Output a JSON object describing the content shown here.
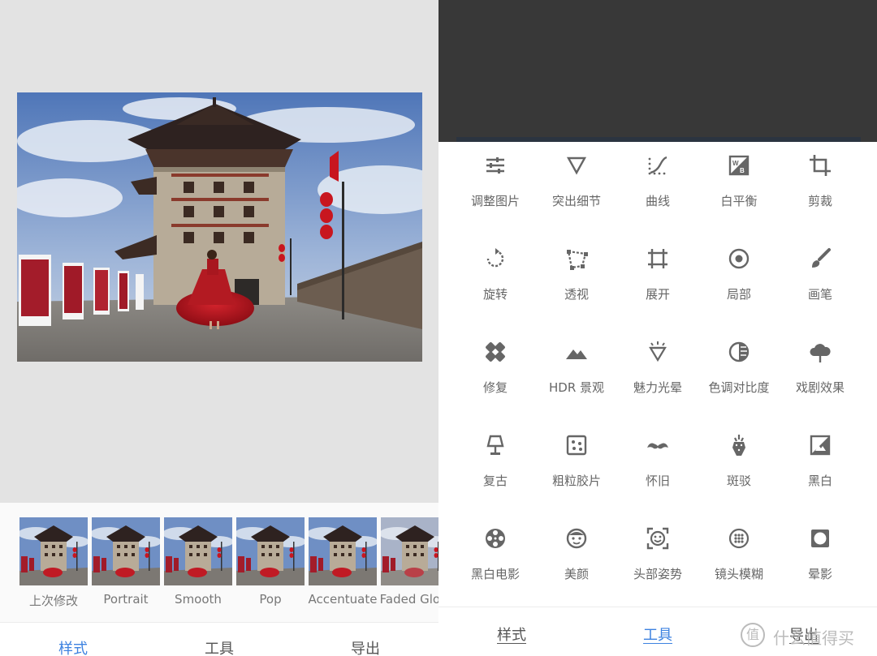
{
  "filters": {
    "items": [
      {
        "label": "上次修改",
        "tone": "normal"
      },
      {
        "label": "Portrait",
        "tone": "normal"
      },
      {
        "label": "Smooth",
        "tone": "normal"
      },
      {
        "label": "Pop",
        "tone": "normal"
      },
      {
        "label": "Accentuate",
        "tone": "normal"
      },
      {
        "label": "Faded Glow",
        "tone": "faded"
      }
    ]
  },
  "left_nav": {
    "styles": "样式",
    "tools": "工具",
    "export": "导出",
    "active": "styles"
  },
  "tools": {
    "items": [
      {
        "label": "调整图片",
        "icon": "tune-icon"
      },
      {
        "label": "突出细节",
        "icon": "details-triangle-icon"
      },
      {
        "label": "曲线",
        "icon": "curves-icon"
      },
      {
        "label": "白平衡",
        "icon": "white-balance-icon"
      },
      {
        "label": "剪裁",
        "icon": "crop-icon"
      },
      {
        "label": "旋转",
        "icon": "rotate-icon"
      },
      {
        "label": "透视",
        "icon": "perspective-icon"
      },
      {
        "label": "展开",
        "icon": "expand-icon"
      },
      {
        "label": "局部",
        "icon": "selective-icon"
      },
      {
        "label": "画笔",
        "icon": "brush-icon"
      },
      {
        "label": "修复",
        "icon": "healing-bandage-icon"
      },
      {
        "label": "HDR 景观",
        "icon": "hdr-mountain-icon"
      },
      {
        "label": "魅力光晕",
        "icon": "glamour-diamond-icon"
      },
      {
        "label": "色调对比度",
        "icon": "tonal-contrast-icon"
      },
      {
        "label": "戏剧效果",
        "icon": "drama-cloud-icon"
      },
      {
        "label": "复古",
        "icon": "vintage-lamp-icon"
      },
      {
        "label": "粗粒胶片",
        "icon": "grainy-film-icon"
      },
      {
        "label": "怀旧",
        "icon": "retrolux-mustache-icon"
      },
      {
        "label": "斑驳",
        "icon": "grunge-guitar-icon"
      },
      {
        "label": "黑白",
        "icon": "black-white-icon"
      },
      {
        "label": "黑白电影",
        "icon": "noir-film-reel-icon"
      },
      {
        "label": "美颜",
        "icon": "face-enhance-icon"
      },
      {
        "label": "头部姿势",
        "icon": "head-pose-icon"
      },
      {
        "label": "镜头模糊",
        "icon": "lens-blur-icon"
      },
      {
        "label": "晕影",
        "icon": "vignette-icon"
      }
    ]
  },
  "right_nav": {
    "styles": "样式",
    "tools": "工具",
    "export": "导出",
    "active": "tools"
  },
  "watermark": {
    "icon_glyph": "值",
    "text": "什么值得买"
  },
  "colors": {
    "accent": "#3d82e0",
    "dark_header": "#383838",
    "preview_bg": "#e3e3e3",
    "icon_gray": "#666666"
  }
}
